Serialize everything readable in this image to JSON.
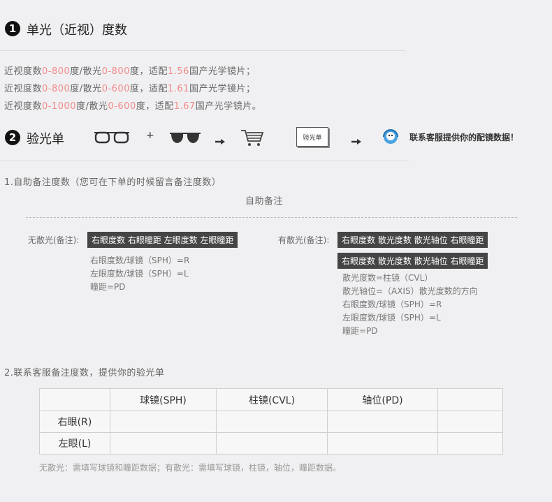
{
  "section1": {
    "number": "1",
    "title": "单光（近视）度数",
    "lines": [
      [
        {
          "t": "近视度数"
        },
        {
          "t": "0-800",
          "red": true
        },
        {
          "t": "度/散光"
        },
        {
          "t": "0-800",
          "red": true
        },
        {
          "t": "度，适配"
        },
        {
          "t": "1.56",
          "red": true
        },
        {
          "t": "国产光学镜片；"
        }
      ],
      [
        {
          "t": "近视度数"
        },
        {
          "t": "0-800",
          "red": true
        },
        {
          "t": "度/散光"
        },
        {
          "t": "0-600",
          "red": true
        },
        {
          "t": "度，适配"
        },
        {
          "t": "1.61",
          "red": true
        },
        {
          "t": "国产光学镜片；"
        }
      ],
      [
        {
          "t": "近视度数"
        },
        {
          "t": "0-1000",
          "red": true
        },
        {
          "t": "度/散光"
        },
        {
          "t": "0-600",
          "red": true
        },
        {
          "t": "度，适配"
        },
        {
          "t": "1.67",
          "red": true
        },
        {
          "t": "国产光学镜片。"
        }
      ]
    ]
  },
  "section2": {
    "number": "2",
    "title": "验光单",
    "plus": "+",
    "card_label": "验光单",
    "contact": "联系客服提供你的配镜数据！",
    "icons": [
      "glasses-icon",
      "sunglasses-icon",
      "arrow-right-icon",
      "shopping-cart-icon",
      "prescription-card-icon",
      "arrow-right-icon",
      "customer-service-icon"
    ]
  },
  "step1": {
    "title": "1.自助备注度数（您可在下单的时候留言备注度数）",
    "subtitle": "自助备注",
    "left": {
      "label": "无散光(备注):",
      "tag": "右眼度数 右眼瞳距 左眼度数 左眼瞳距",
      "notes": [
        "右眼度数/球镜（SPH）=R",
        "左眼度数/球镜（SPH）=L",
        "瞳距=PD"
      ]
    },
    "right": {
      "label": "有散光(备注):",
      "tag1": "右眼度数 散光度数 散光轴位 右眼瞳距",
      "tag2": "右眼度数 散光度数 散光轴位 右眼瞳距",
      "notes": [
        "散光度数=柱镜（CVL）",
        "散光轴位=（AXIS）散光度数的方向",
        "右眼度数/球镜（SPH）=R",
        "左眼度数/球镜（SPH）=L",
        "瞳距=PD"
      ]
    }
  },
  "step2": {
    "title": "2.联系客服备注度数，提供你的验光单",
    "table": {
      "headers": [
        "",
        "球镜(SPH)",
        "柱镜(CVL)",
        "轴位(PD)",
        ""
      ],
      "rows": [
        [
          "右眼(R)",
          "",
          "",
          "",
          ""
        ],
        [
          "左眼(L)",
          "",
          "",
          "",
          ""
        ]
      ]
    },
    "footnote": "无散光：需填写球镜和瞳距数据；有散光：需填写球镜，柱镜，轴位，瞳距数据。"
  },
  "colors": {
    "accent_red": "#f28a8a",
    "tag_bg": "#454545",
    "background": "#f0f0f2"
  }
}
